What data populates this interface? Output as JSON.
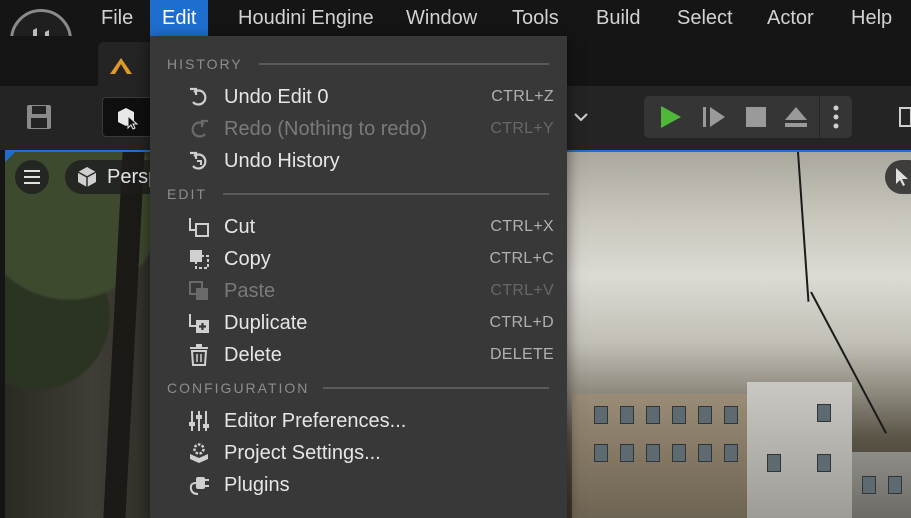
{
  "menubar": {
    "items": [
      "File",
      "Edit",
      "Houdini Engine",
      "Window",
      "Tools",
      "Build",
      "Select",
      "Actor",
      "Help"
    ],
    "active": "Edit"
  },
  "viewport": {
    "perspective_label": "Persp"
  },
  "colors": {
    "accent": "#1e6ecf",
    "play_green": "#4fb83a",
    "menu_bg": "#383838",
    "section_text": "#8d8d8d"
  },
  "edit_menu": {
    "sections": {
      "history": "HISTORY",
      "edit": "EDIT",
      "configuration": "CONFIGURATION"
    },
    "history_items": [
      {
        "label": "Undo Edit 0",
        "shortcut": "CTRL+Z",
        "icon": "undo-icon",
        "enabled": true
      },
      {
        "label": "Redo (Nothing to redo)",
        "shortcut": "CTRL+Y",
        "icon": "redo-icon",
        "enabled": false
      },
      {
        "label": "Undo History",
        "shortcut": "",
        "icon": "undo-history-icon",
        "enabled": true
      }
    ],
    "edit_items": [
      {
        "label": "Cut",
        "shortcut": "CTRL+X",
        "icon": "cut-icon",
        "enabled": true
      },
      {
        "label": "Copy",
        "shortcut": "CTRL+C",
        "icon": "copy-icon",
        "enabled": true
      },
      {
        "label": "Paste",
        "shortcut": "CTRL+V",
        "icon": "paste-icon",
        "enabled": false
      },
      {
        "label": "Duplicate",
        "shortcut": "CTRL+D",
        "icon": "duplicate-icon",
        "enabled": true
      },
      {
        "label": "Delete",
        "shortcut": "DELETE",
        "icon": "trash-icon",
        "enabled": true
      }
    ],
    "config_items": [
      {
        "label": "Editor Preferences...",
        "icon": "sliders-icon"
      },
      {
        "label": "Project Settings...",
        "icon": "gear-box-icon"
      },
      {
        "label": "Plugins",
        "icon": "plug-icon"
      }
    ]
  }
}
